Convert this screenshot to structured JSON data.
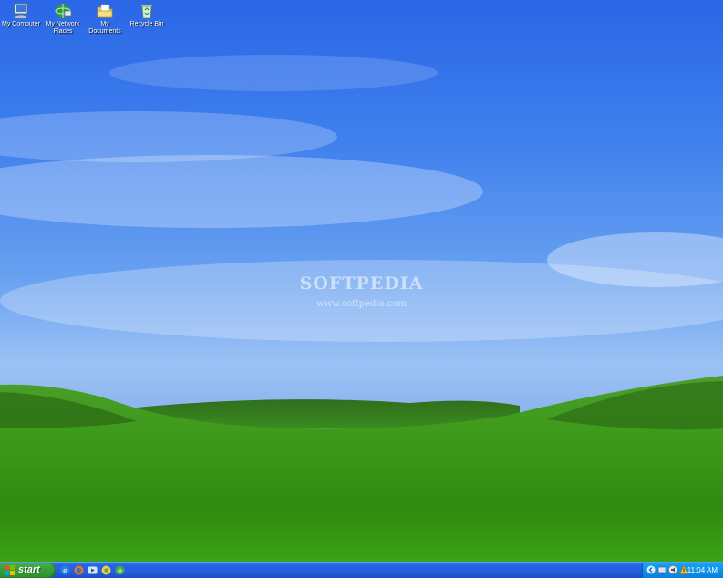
{
  "desktop": {
    "icons": [
      {
        "label": "My Computer",
        "icon": "my-computer-icon"
      },
      {
        "label": "My Network Places",
        "icon": "network-places-icon"
      },
      {
        "label": "My Documents",
        "icon": "documents-folder-icon"
      },
      {
        "label": "Recycle Bin",
        "icon": "recycle-bin-icon"
      }
    ],
    "watermark": {
      "title": "SOFTPEDIA",
      "url": "www.softpedia.com"
    }
  },
  "taskbar": {
    "start_label": "start",
    "quick_launch": [
      "internet-explorer-icon",
      "firefox-icon",
      "media-player-icon",
      "messenger-icon",
      "browser-icon"
    ],
    "tray_icons": [
      "arrow-icon",
      "network-icon",
      "volume-icon",
      "security-icon"
    ],
    "clock": "11:04 AM"
  },
  "colors": {
    "taskbar": "#245ddb",
    "start": "#37a337",
    "tray": "#0f8ee7"
  }
}
